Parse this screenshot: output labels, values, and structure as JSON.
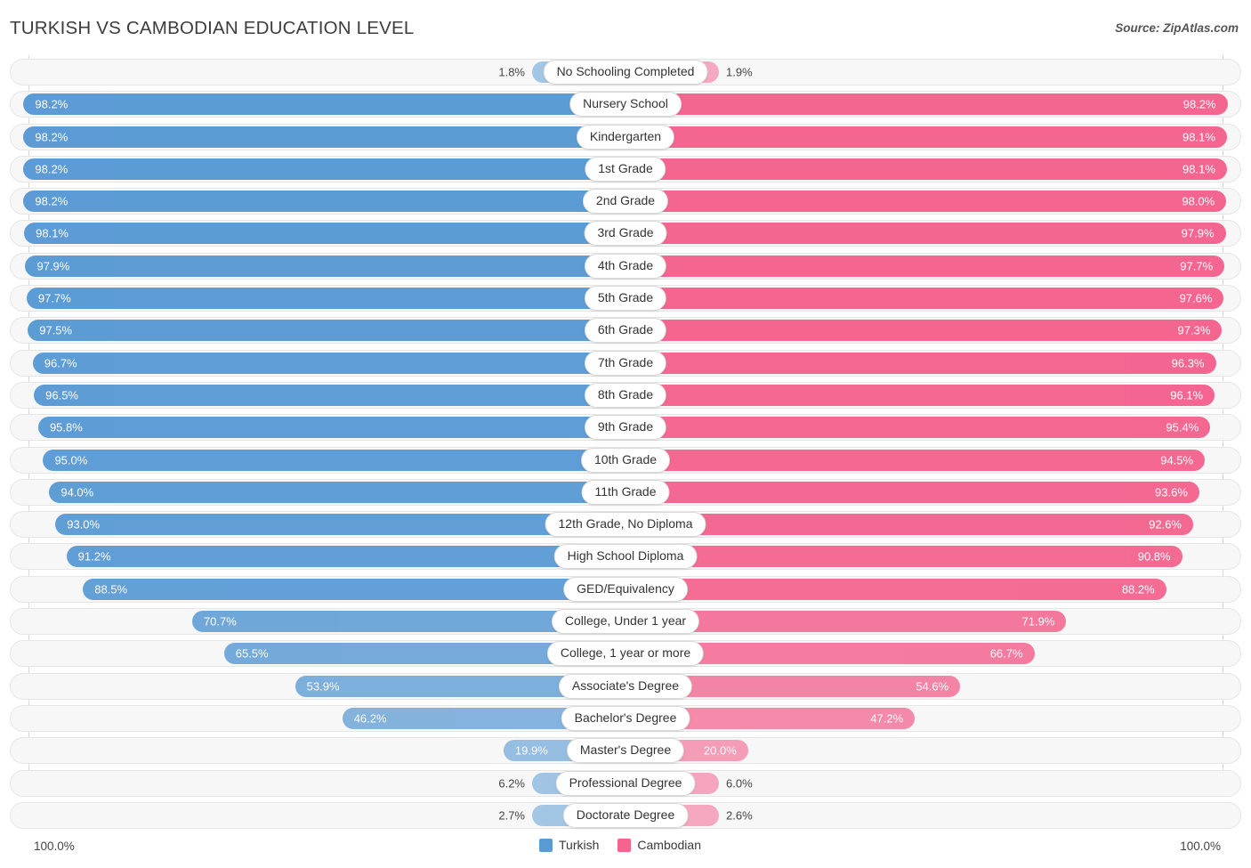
{
  "header": {
    "title": "TURKISH VS CAMBODIAN EDUCATION LEVEL",
    "source": "Source: ZipAtlas.com"
  },
  "axis": {
    "left_max": "100.0%",
    "right_max": "100.0%"
  },
  "legend": {
    "items": [
      {
        "label": "Turkish",
        "color": "#5b9bd5"
      },
      {
        "label": "Cambodian",
        "color": "#f4648f"
      }
    ]
  },
  "colors": {
    "turkish": "#5b9bd5",
    "cambodian": "#f4648f",
    "track": "#f7f7f7",
    "track_border": "#e6e6e6",
    "gridline": "#d8d8d8"
  },
  "chart_data": {
    "type": "bar",
    "title": "TURKISH VS CAMBODIAN EDUCATION LEVEL",
    "subtitle": "Source: ZipAtlas.com",
    "orientation": "horizontal-diverging",
    "xlabel": "",
    "ylabel": "",
    "xlim": [
      0,
      100
    ],
    "grid": true,
    "legend_position": "bottom-center",
    "categories": [
      "No Schooling Completed",
      "Nursery School",
      "Kindergarten",
      "1st Grade",
      "2nd Grade",
      "3rd Grade",
      "4th Grade",
      "5th Grade",
      "6th Grade",
      "7th Grade",
      "8th Grade",
      "9th Grade",
      "10th Grade",
      "11th Grade",
      "12th Grade, No Diploma",
      "High School Diploma",
      "GED/Equivalency",
      "College, Under 1 year",
      "College, 1 year or more",
      "Associate's Degree",
      "Bachelor's Degree",
      "Master's Degree",
      "Professional Degree",
      "Doctorate Degree"
    ],
    "series": [
      {
        "name": "Turkish",
        "color": "#5b9bd5",
        "values": [
          1.8,
          98.2,
          98.2,
          98.2,
          98.2,
          98.1,
          97.9,
          97.7,
          97.5,
          96.7,
          96.5,
          95.8,
          95.0,
          94.0,
          93.0,
          91.2,
          88.5,
          70.7,
          65.5,
          53.9,
          46.2,
          19.9,
          6.2,
          2.7
        ],
        "labels": [
          "1.8%",
          "98.2%",
          "98.2%",
          "98.2%",
          "98.2%",
          "98.1%",
          "97.9%",
          "97.7%",
          "97.5%",
          "96.7%",
          "96.5%",
          "95.8%",
          "95.0%",
          "94.0%",
          "93.0%",
          "91.2%",
          "88.5%",
          "70.7%",
          "65.5%",
          "53.9%",
          "46.2%",
          "19.9%",
          "6.2%",
          "2.7%"
        ]
      },
      {
        "name": "Cambodian",
        "color": "#f4648f",
        "values": [
          1.9,
          98.2,
          98.1,
          98.1,
          98.0,
          97.9,
          97.7,
          97.6,
          97.3,
          96.3,
          96.1,
          95.4,
          94.5,
          93.6,
          92.6,
          90.8,
          88.2,
          71.9,
          66.7,
          54.6,
          47.2,
          20.0,
          6.0,
          2.6
        ],
        "labels": [
          "1.9%",
          "98.2%",
          "98.1%",
          "98.1%",
          "98.0%",
          "97.9%",
          "97.7%",
          "97.6%",
          "97.3%",
          "96.3%",
          "96.1%",
          "95.4%",
          "94.5%",
          "93.6%",
          "92.6%",
          "90.8%",
          "88.2%",
          "71.9%",
          "66.7%",
          "54.6%",
          "47.2%",
          "20.0%",
          "6.0%",
          "2.6%"
        ]
      }
    ]
  }
}
